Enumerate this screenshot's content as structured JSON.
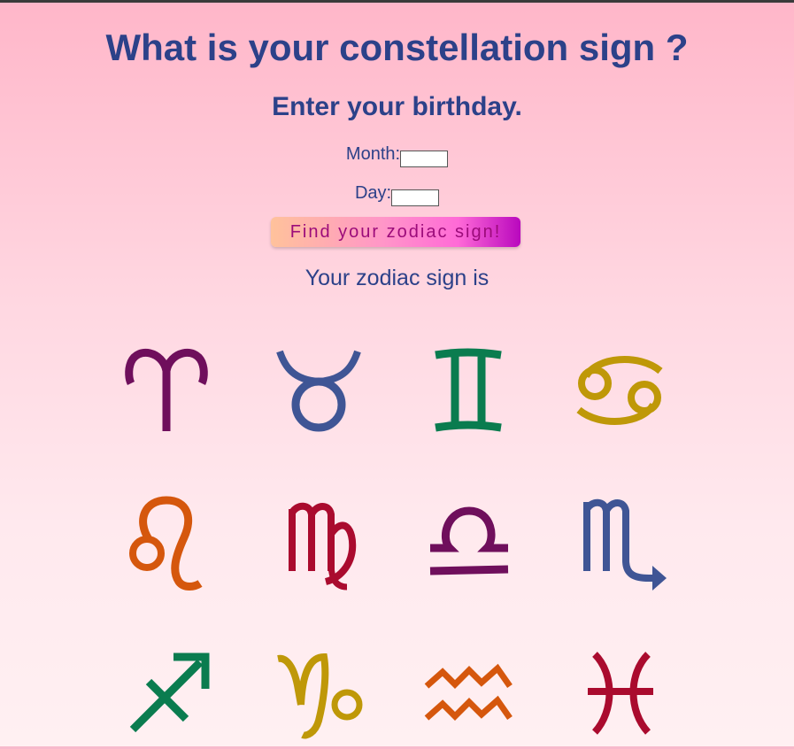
{
  "page": {
    "title": "What is your constellation sign ?",
    "subtitle": "Enter your birthday."
  },
  "form": {
    "month_label": "Month:",
    "month_value": "",
    "day_label": "Day:",
    "day_value": "",
    "submit_label": "Find your zodiac sign!"
  },
  "result": {
    "text": "Your zodiac sign is"
  },
  "zodiac_signs": [
    {
      "name": "aries-icon",
      "color": "#6f0f5c"
    },
    {
      "name": "taurus-icon",
      "color": "#3f5595"
    },
    {
      "name": "gemini-icon",
      "color": "#0a7c4f"
    },
    {
      "name": "cancer-icon",
      "color": "#bf9808"
    },
    {
      "name": "leo-icon",
      "color": "#d5570d"
    },
    {
      "name": "virgo-icon",
      "color": "#aa0b2e"
    },
    {
      "name": "libra-icon",
      "color": "#6f0f5c"
    },
    {
      "name": "scorpio-icon",
      "color": "#3f5595"
    },
    {
      "name": "sagittarius-icon",
      "color": "#0a7c4f"
    },
    {
      "name": "capricorn-icon",
      "color": "#bf9808"
    },
    {
      "name": "aquarius-icon",
      "color": "#d5570d"
    },
    {
      "name": "pisces-icon",
      "color": "#aa0b2e"
    }
  ]
}
